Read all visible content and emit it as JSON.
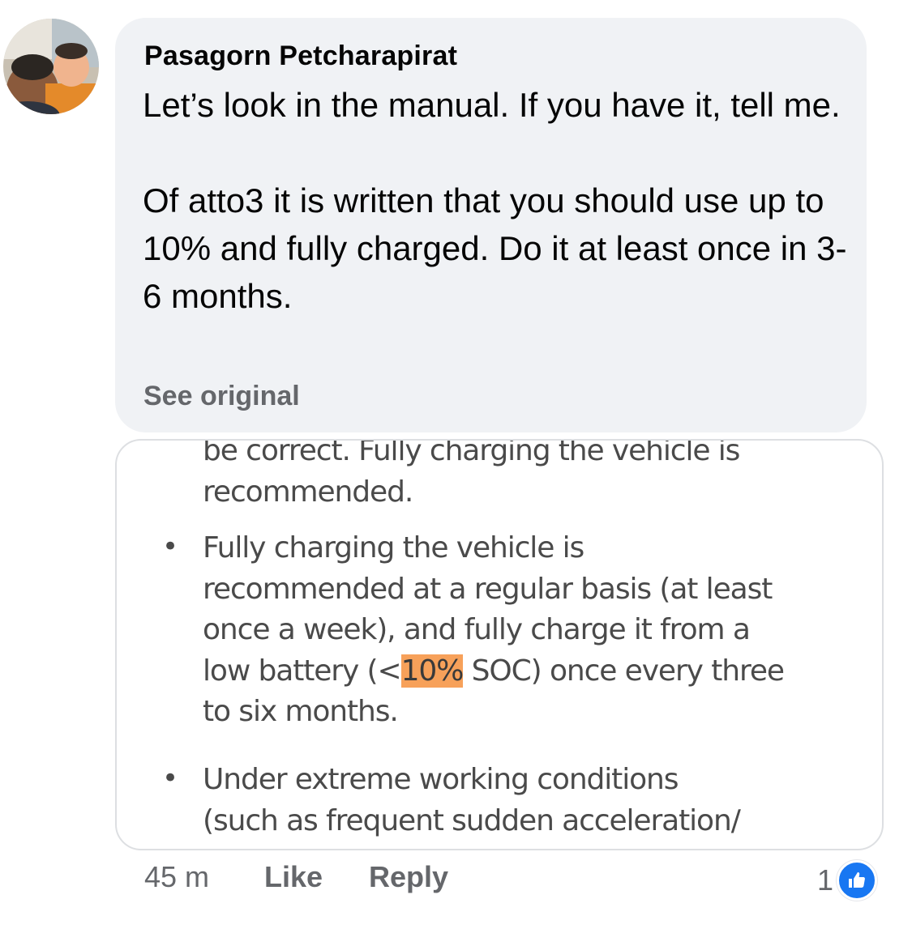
{
  "comment": {
    "author": "Pasagorn Petcharapirat",
    "paragraphs": [
      "Let’s look in the manual. If you have it, tell me.",
      "Of atto3 it is written that you should use up to 10% and fully charged. Do it at least once in 3-6 months."
    ],
    "see_original": "See original"
  },
  "attachment": {
    "lines": {
      "l1": "be correct. Fully charging the vehicle is",
      "l2": "recommended.",
      "b1_l1": "Fully charging the vehicle is",
      "b1_l2": "recommended at a regular basis (at least",
      "b1_l3": "once a week), and fully charge it from a",
      "b1_l4_pre": "low battery (<",
      "b1_l4_hl": "10%",
      "b1_l4_post": " SOC) once every three",
      "b1_l5": "to six months.",
      "b2_l1": "Under extreme working conditions",
      "b2_l2": "(such as frequent sudden acceleration/"
    },
    "bullet_char": "•",
    "highlight_color": "#f7a15a"
  },
  "footer": {
    "time": "45 m",
    "like": "Like",
    "reply": "Reply",
    "reaction_count": "1",
    "reaction_icon": "thumbs-up-icon"
  },
  "colors": {
    "bubble": "#f0f2f5",
    "secondary_text": "#65676b",
    "like_blue": "#1877f2"
  }
}
